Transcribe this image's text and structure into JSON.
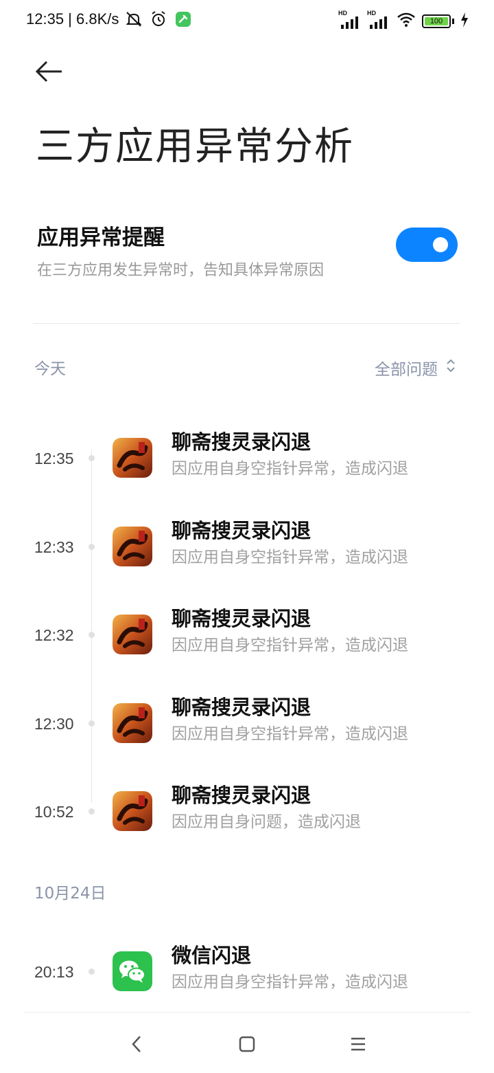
{
  "status_bar": {
    "time_speed": "12:35 | 6.8K/s",
    "signal_1_label": "HD",
    "signal_2_label": "HD",
    "battery_level": "100",
    "battery_percent": 100,
    "icons": [
      "mute-icon",
      "alarm-icon",
      "app-notification-icon",
      "signal-icon",
      "signal-icon",
      "wifi-icon",
      "battery-icon",
      "charging-icon"
    ]
  },
  "header": {
    "back_icon": "back-arrow-icon",
    "title": "三方应用异常分析"
  },
  "setting": {
    "title": "应用异常提醒",
    "subtitle": "在三方应用发生异常时，告知具体异常原因",
    "enabled": true,
    "accent_color": "#0d84ff"
  },
  "today": {
    "label": "今天",
    "filter_label": "全部问题",
    "entries": [
      {
        "time": "12:35",
        "title": "聊斋搜灵录闪退",
        "subtitle": "因应用自身空指针异常，造成闪退"
      },
      {
        "time": "12:33",
        "title": "聊斋搜灵录闪退",
        "subtitle": "因应用自身空指针异常，造成闪退"
      },
      {
        "time": "12:32",
        "title": "聊斋搜灵录闪退",
        "subtitle": "因应用自身空指针异常，造成闪退"
      },
      {
        "time": "12:30",
        "title": "聊斋搜灵录闪退",
        "subtitle": "因应用自身空指针异常，造成闪退"
      },
      {
        "time": "10:52",
        "title": "聊斋搜灵录闪退",
        "subtitle": "因应用自身问题，造成闪退"
      }
    ]
  },
  "oct24": {
    "label": "10月24日",
    "entries": [
      {
        "time": "20:13",
        "title": "微信闪退",
        "subtitle": "因应用自身空指针异常，造成闪退"
      }
    ]
  },
  "nav": {
    "icons": [
      "nav-back-icon",
      "nav-home-icon",
      "nav-recents-icon"
    ]
  }
}
